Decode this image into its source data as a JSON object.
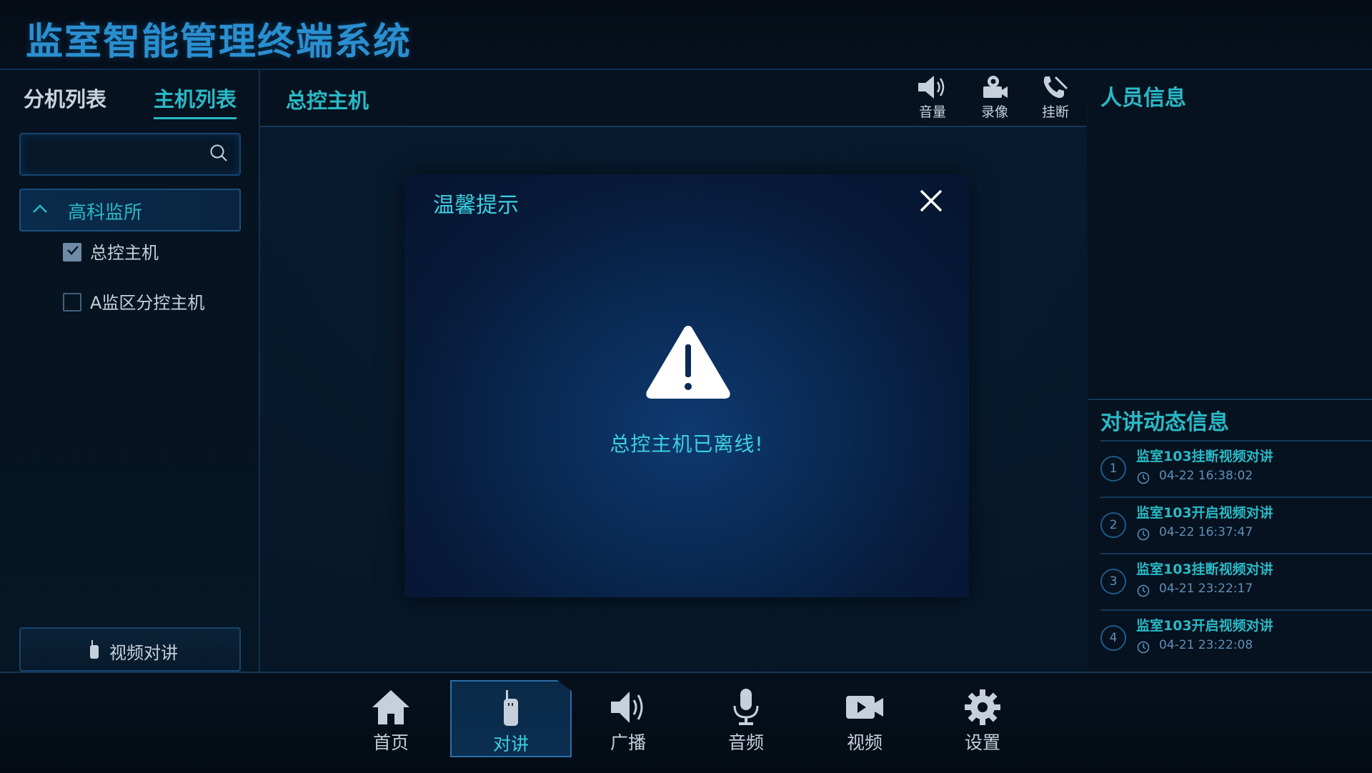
{
  "app": {
    "title": "监室智能管理终端系统"
  },
  "left_panel": {
    "tabs": [
      {
        "label": "分机列表",
        "active": false
      },
      {
        "label": "主机列表",
        "active": true
      }
    ],
    "search": {
      "placeholder": "",
      "value": "",
      "icon": "search-icon"
    },
    "group": {
      "label": "高科监所",
      "expanded": true,
      "icon": "chevron-up-icon"
    },
    "devices": [
      {
        "label": "总控主机",
        "checked": true
      },
      {
        "label": "A监区分控主机",
        "checked": false
      }
    ],
    "video_button": {
      "label": "视频对讲",
      "icon": "walkie-talkie-icon"
    }
  },
  "center": {
    "title": "总控主机",
    "controls": [
      {
        "label": "音量",
        "icon": "speaker-icon"
      },
      {
        "label": "录像",
        "icon": "camera-icon"
      },
      {
        "label": "挂断",
        "icon": "hangup-icon"
      }
    ]
  },
  "modal": {
    "title": "温馨提示",
    "message": "总控主机已离线!",
    "icon": "warning-icon",
    "close_icon": "close-icon"
  },
  "right_panel": {
    "person_title": "人员信息",
    "log_title": "对讲动态信息",
    "log_items": [
      {
        "num": "1",
        "title": "监室103挂断视频对讲",
        "time": "04-22 16:38:02"
      },
      {
        "num": "2",
        "title": "监室103开启视频对讲",
        "time": "04-22 16:37:47"
      },
      {
        "num": "3",
        "title": "监室103挂断视频对讲",
        "time": "04-21 23:22:17"
      },
      {
        "num": "4",
        "title": "监室103开启视频对讲",
        "time": "04-21 23:22:08"
      }
    ]
  },
  "bottom_nav": [
    {
      "label": "首页",
      "icon": "home-icon",
      "active": false
    },
    {
      "label": "对讲",
      "icon": "intercom-icon",
      "active": true
    },
    {
      "label": "广播",
      "icon": "broadcast-icon",
      "active": false
    },
    {
      "label": "音频",
      "icon": "microphone-icon",
      "active": false
    },
    {
      "label": "视频",
      "icon": "video-icon",
      "active": false
    },
    {
      "label": "设置",
      "icon": "settings-icon",
      "active": false
    }
  ],
  "colors": {
    "accent": "#2ab9c6",
    "title_blue": "#2a8fd0",
    "background": "#06121f",
    "border": "#13385a"
  }
}
